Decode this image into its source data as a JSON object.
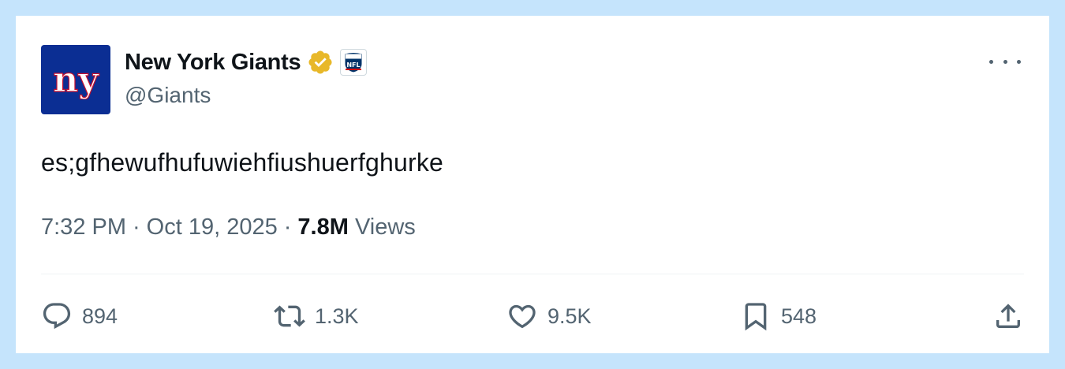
{
  "tweet": {
    "author": {
      "display_name": "New York Giants",
      "handle": "@Giants",
      "avatar_text": "ny",
      "verified_badge_color": "#e8b829",
      "affiliation": "NFL"
    },
    "text": "es;gfhewufhufuwiehfiushuerfghurke",
    "time": "7:32 PM",
    "separator": "·",
    "date": "Oct 19, 2025",
    "views_count": "7.8M",
    "views_label": "Views"
  },
  "actions": {
    "replies": "894",
    "reposts": "1.3K",
    "likes": "9.5K",
    "bookmarks": "548"
  },
  "colors": {
    "background": "#c5e4fc",
    "text_primary": "#0f1419",
    "text_secondary": "#536471",
    "avatar_bg": "#0b2e93"
  }
}
